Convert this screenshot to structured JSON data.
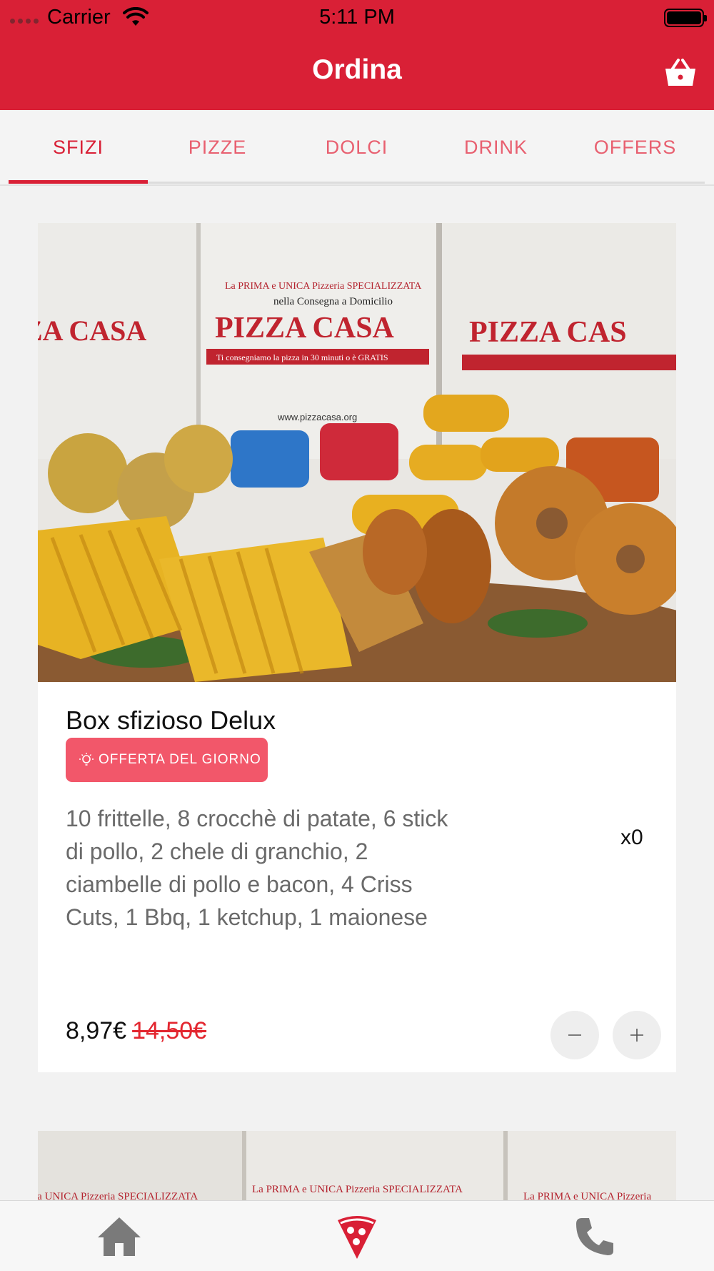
{
  "status_bar": {
    "carrier": "Carrier",
    "time": "5:11 PM"
  },
  "header": {
    "title": "Ordina",
    "cart_icon": "basket-icon",
    "background_color": "#d92036"
  },
  "tabs": [
    {
      "label": "SFIZI",
      "active": true
    },
    {
      "label": "PIZZE",
      "active": false
    },
    {
      "label": "DOLCI",
      "active": false
    },
    {
      "label": "DRINK",
      "active": false
    },
    {
      "label": "OFFERS",
      "active": false
    }
  ],
  "product": {
    "name": "Box sfizioso Delux",
    "badge": "OFFERTA DEL GIORNO",
    "description": "10 frittelle, 8 crocchè di patate, 6 stick di pollo, 2 chele di granchio, 2 ciambelle di pollo e bacon, 4 Criss Cuts, 1 Bbq, 1 ketchup, 1 maionese",
    "quantity": "x0",
    "price": "8,97€",
    "old_price": "14,50€",
    "image_text": {
      "line1": "La PRIMA e UNICA Pizzeria SPECIALIZZATA",
      "line2": "nella Consegna a Domicilio",
      "brand": "PIZZA CASA",
      "tagline": "Ti consegniamo la pizza in 30 minuti o è GRATIS",
      "url": "www.pizzacasa.org"
    }
  },
  "bottom_nav": [
    {
      "icon": "home-icon"
    },
    {
      "icon": "pizza-slice-icon",
      "active": true
    },
    {
      "icon": "phone-icon"
    }
  ],
  "colors": {
    "accent": "#d92036",
    "badge": "#f2576a",
    "old_price": "#e3262f"
  }
}
